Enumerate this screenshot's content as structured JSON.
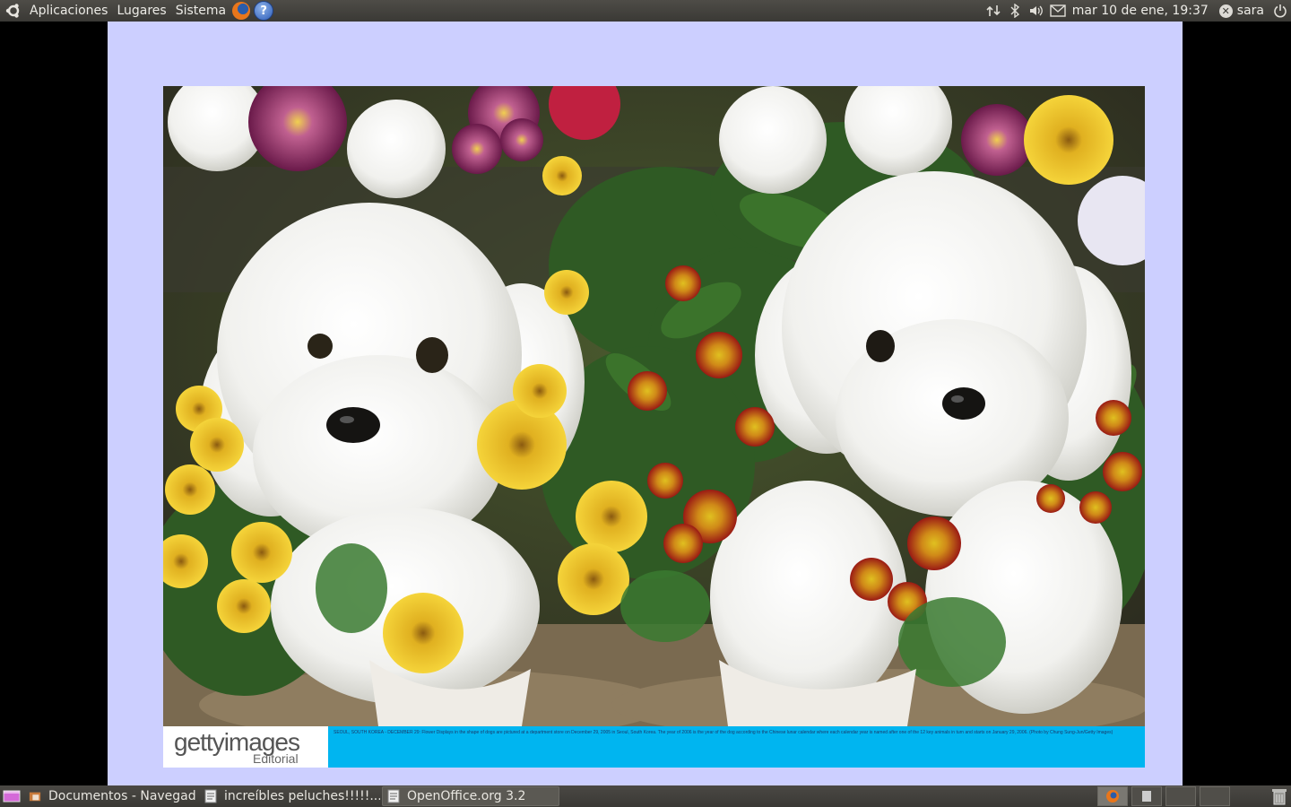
{
  "top_panel": {
    "menus": [
      "Aplicaciones",
      "Lugares",
      "Sistema"
    ],
    "help_glyph": "?",
    "clock": "mar 10 de ene, 19:37",
    "user": "sara",
    "tray_icons": [
      "network-icon",
      "bluetooth-icon",
      "volume-icon",
      "mail-icon",
      "power-icon"
    ]
  },
  "photo": {
    "watermark_brand": "gettyimages",
    "watermark_sub": "Editorial",
    "caption": "SEOUL, SOUTH KOREA - DECEMBER 29: Flower Displays in the shape of dogs are pictured at a department store on December 29, 2005 in Seoul, South Korea. The year of 2006 is the year of the dog according to the Chinese lunar calendar where each calendar year is named after one of the 12 key animals in turn and starts on January 29, 2006. (Photo by Chung Sung-Jun/Getty Images)"
  },
  "taskbar": {
    "tasks": [
      {
        "label": "Documentos - Navegad..."
      },
      {
        "label": "increíbles peluches!!!!!..."
      },
      {
        "label": "OpenOffice.org 3.2"
      }
    ]
  },
  "colors": {
    "panel": "#3c3b37",
    "viewer_bg": "#cccfff",
    "caption_bar": "#00b5f0"
  }
}
